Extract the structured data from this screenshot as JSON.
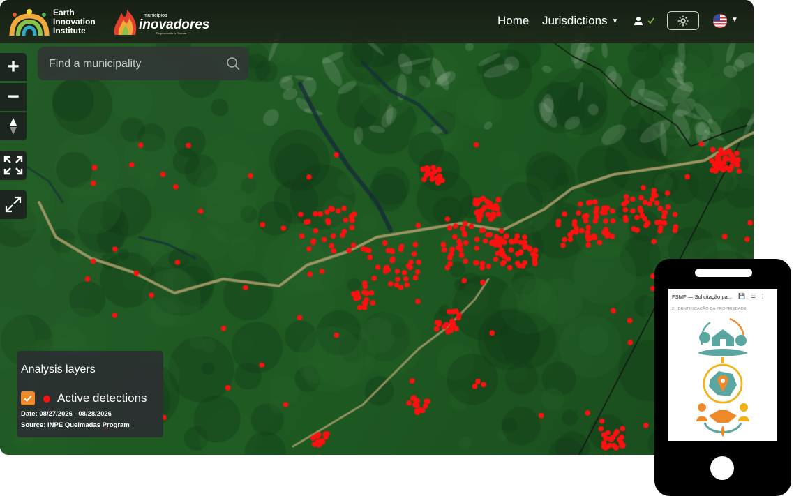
{
  "header": {
    "brand": {
      "line1": "Earth",
      "line2": "Innovation",
      "line3": "Institute"
    },
    "partner": {
      "small": "municípios",
      "big": "inovadores",
      "tagline": "Regenerando a Floresta"
    },
    "nav": {
      "home": "Home",
      "jurisdictions": "Jurisdictions"
    },
    "icons": {
      "user": "user-icon",
      "theme": "sun-icon",
      "language": "us-flag-icon"
    }
  },
  "search": {
    "placeholder": "Find a municipality",
    "icon": "search-icon"
  },
  "controls": {
    "zoom_in": "+",
    "zoom_out": "−",
    "compass": "compass-icon",
    "fullscreen": "fullscreen-icon",
    "expand": "expand-icon"
  },
  "legend": {
    "title": "Analysis layers",
    "layer_label": "Active detections",
    "layer_checked": true,
    "date": "Date: 08/27/2026 - 08/28/2026",
    "source": "Source: INPE Queimadas Program"
  },
  "phone": {
    "app_title": "FSMF — Solicitação pa...",
    "section": "2. IDENTIFICAÇÃO DA PROPRIEDADE"
  },
  "colors": {
    "detection": "#ff1010",
    "accent_orange": "#ef8a2a",
    "header_bg": "#1c2519",
    "panel_bg": "#2b3032",
    "forest": "#1f5222"
  }
}
